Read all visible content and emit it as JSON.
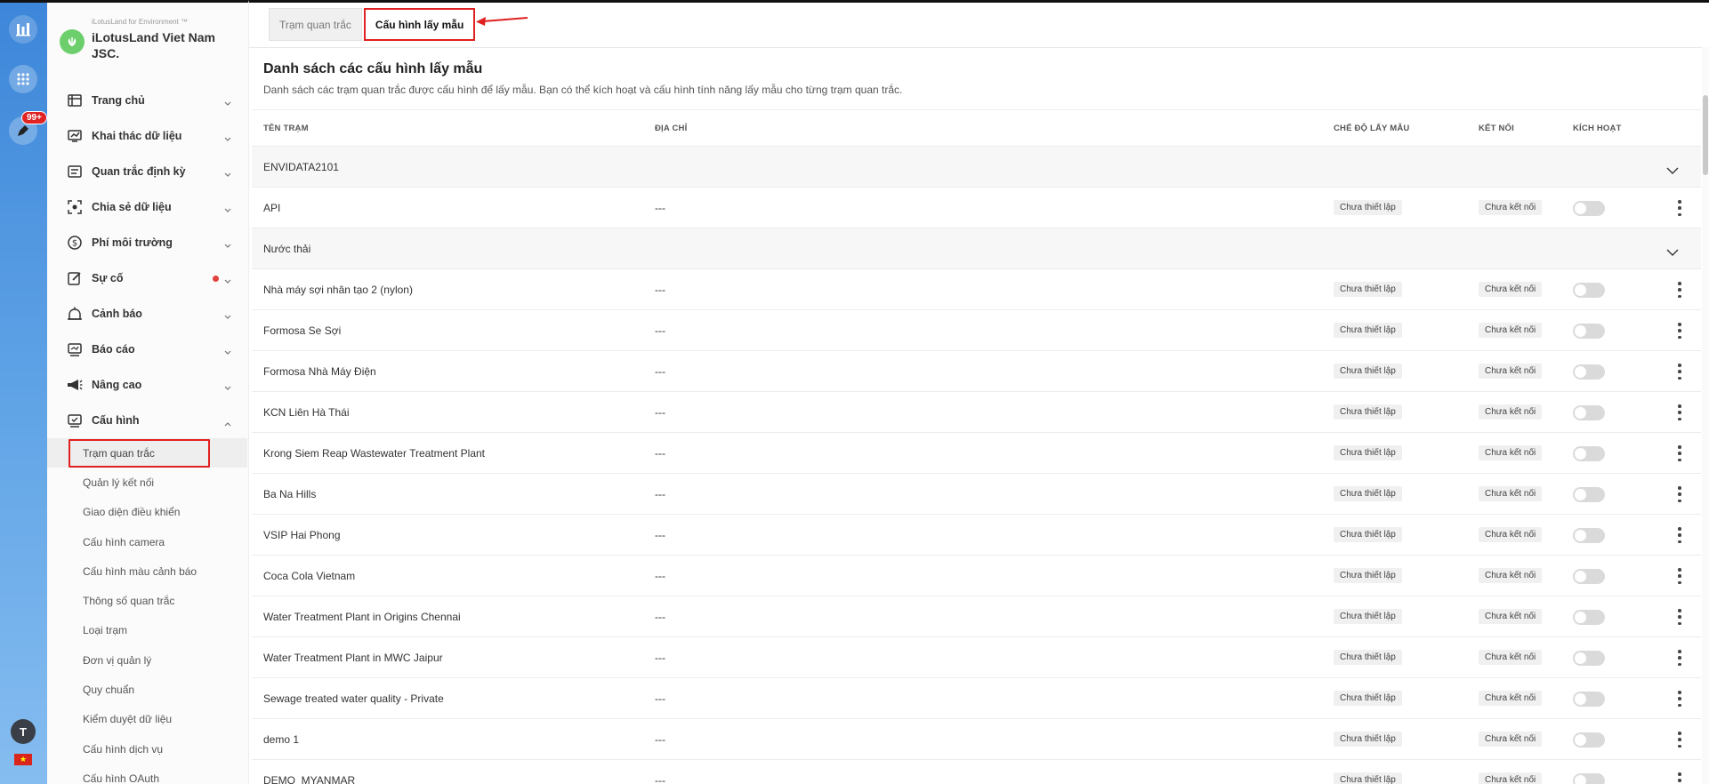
{
  "rail": {
    "notification_badge": "99+",
    "avatar_initial": "T",
    "flag_symbol": "★"
  },
  "brand": {
    "subtitle": "iLotusLand for Environment ™",
    "name": "iLotusLand Viet Nam JSC."
  },
  "menu": [
    {
      "label": "Trang chủ",
      "name": "menu-trang-chu",
      "icon": "home-icon"
    },
    {
      "label": "Khai thác dữ liệu",
      "name": "menu-khai-thac-du-lieu",
      "icon": "data-icon"
    },
    {
      "label": "Quan trắc định kỳ",
      "name": "menu-quan-trac-dinh-ky",
      "icon": "document-icon"
    },
    {
      "label": "Chia sẻ dữ liệu",
      "name": "menu-chia-se-du-lieu",
      "icon": "share-icon"
    },
    {
      "label": "Phí môi trường",
      "name": "menu-phi-moi-truong",
      "icon": "dollar-icon"
    },
    {
      "label": "Sự cố",
      "name": "menu-su-co",
      "icon": "edit-icon"
    },
    {
      "label": "Cảnh báo",
      "name": "menu-canh-bao",
      "icon": "bell-icon"
    },
    {
      "label": "Báo cáo",
      "name": "menu-bao-cao",
      "icon": "report-icon"
    },
    {
      "label": "Nâng cao",
      "name": "menu-nang-cao",
      "icon": "megaphone-icon"
    },
    {
      "label": "Cấu hình",
      "name": "menu-cau-hinh",
      "icon": "settings-icon"
    }
  ],
  "submenu": [
    "Trạm quan trắc",
    "Quản lý kết nối",
    "Giao diện điều khiển",
    "Cấu hình camera",
    "Cấu hình màu cảnh báo",
    "Thông số quan trắc",
    "Loại trạm",
    "Đơn vị quản lý",
    "Quy chuẩn",
    "Kiểm duyệt dữ liệu",
    "Cấu hình dịch vụ",
    "Cấu hình OAuth"
  ],
  "tabs": {
    "tab1": "Trạm quan trắc",
    "tab2": "Cấu hình lấy mẫu"
  },
  "page": {
    "title": "Danh sách các cấu hình lấy mẫu",
    "description": "Danh sách các trạm quan trắc được cấu hình để lấy mẫu. Bạn có thể kích hoạt và cấu hình tính năng lấy mẫu cho từng trạm quan trắc."
  },
  "table": {
    "headers": {
      "name": "TÊN TRẠM",
      "address": "ĐỊA CHỈ",
      "mode": "CHẾ ĐỘ LẤY MẪU",
      "connection": "KẾT NỐI",
      "active": "KÍCH HOẠT"
    },
    "rows": [
      {
        "type": "group",
        "name": "ENVIDATA2101"
      },
      {
        "type": "station",
        "name": "API",
        "address": "---",
        "mode": "Chưa thiết lập",
        "connection": "Chưa kết nối"
      },
      {
        "type": "group",
        "name": "Nước thải"
      },
      {
        "type": "station",
        "name": "Nhà máy sợi nhân tạo 2 (nylon)",
        "address": "---",
        "mode": "Chưa thiết lập",
        "connection": "Chưa kết nối"
      },
      {
        "type": "station",
        "name": "Formosa Se Sợi",
        "address": "---",
        "mode": "Chưa thiết lập",
        "connection": "Chưa kết nối"
      },
      {
        "type": "station",
        "name": "Formosa Nhà Máy Điện",
        "address": "---",
        "mode": "Chưa thiết lập",
        "connection": "Chưa kết nối"
      },
      {
        "type": "station",
        "name": "KCN Liên Hà Thái",
        "address": "---",
        "mode": "Chưa thiết lập",
        "connection": "Chưa kết nối"
      },
      {
        "type": "station",
        "name": "Krong Siem Reap Wastewater Treatment Plant",
        "address": "---",
        "mode": "Chưa thiết lập",
        "connection": "Chưa kết nối"
      },
      {
        "type": "station",
        "name": "Ba Na Hills",
        "address": "---",
        "mode": "Chưa thiết lập",
        "connection": "Chưa kết nối"
      },
      {
        "type": "station",
        "name": "VSIP Hai Phong",
        "address": "---",
        "mode": "Chưa thiết lập",
        "connection": "Chưa kết nối"
      },
      {
        "type": "station",
        "name": "Coca Cola Vietnam",
        "address": "---",
        "mode": "Chưa thiết lập",
        "connection": "Chưa kết nối"
      },
      {
        "type": "station",
        "name": "Water Treatment Plant in Origins Chennai",
        "address": "---",
        "mode": "Chưa thiết lập",
        "connection": "Chưa kết nối"
      },
      {
        "type": "station",
        "name": "Water Treatment Plant in MWC Jaipur",
        "address": "---",
        "mode": "Chưa thiết lập",
        "connection": "Chưa kết nối"
      },
      {
        "type": "station",
        "name": "Sewage treated water quality - Private",
        "address": "---",
        "mode": "Chưa thiết lập",
        "connection": "Chưa kết nối"
      },
      {
        "type": "station",
        "name": "demo 1",
        "address": "---",
        "mode": "Chưa thiết lập",
        "connection": "Chưa kết nối"
      },
      {
        "type": "station",
        "name": "DEMO_MYANMAR",
        "address": "---",
        "mode": "Chưa thiết lập",
        "connection": "Chưa kết nối"
      }
    ]
  },
  "colors": {
    "accent_red": "#e02020",
    "rail_blue": "#3d86d9",
    "brand_green": "#6ccf6c"
  }
}
